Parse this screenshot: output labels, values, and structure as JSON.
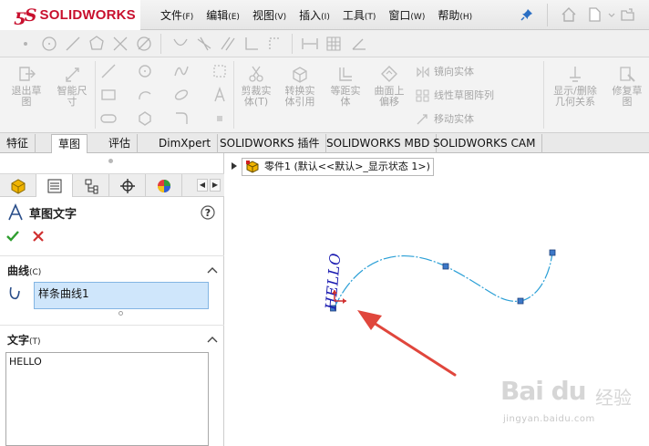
{
  "app": {
    "logo_mark": "ƽS",
    "logo_text": "SOLIDWORKS",
    "brand_color": "#c8102e"
  },
  "menu": [
    {
      "label": "文件",
      "acc": "(F)"
    },
    {
      "label": "编辑",
      "acc": "(E)"
    },
    {
      "label": "视图",
      "acc": "(V)"
    },
    {
      "label": "插入",
      "acc": "(I)"
    },
    {
      "label": "工具",
      "acc": "(T)"
    },
    {
      "label": "窗口",
      "acc": "(W)"
    },
    {
      "label": "帮助",
      "acc": "(H)"
    }
  ],
  "ribbon": {
    "exit_sketch": [
      "退出草",
      "图"
    ],
    "smart_dimension": [
      "智能尺",
      "寸"
    ],
    "trim": [
      "剪裁实",
      "体(T)"
    ],
    "convert": [
      "转换实",
      "体引用"
    ],
    "offset": [
      "等距实",
      "体"
    ],
    "surface_offset": [
      "曲面上",
      "偏移"
    ],
    "mirror": "镜向实体",
    "pattern": "线性草图阵列",
    "move": "移动实体",
    "display_delete": [
      "显示/删除",
      "几何关系"
    ],
    "repair": [
      "修复草",
      "图"
    ],
    "disabled_color": "#a7a7a7"
  },
  "cm_tabs": [
    {
      "label": "特征",
      "active": false
    },
    {
      "label": "草图",
      "active": true
    },
    {
      "label": "评估",
      "active": false
    },
    {
      "label": "DimXpert",
      "active": false
    },
    {
      "label": "SOLIDWORKS 插件",
      "active": false
    },
    {
      "label": "SOLIDWORKS MBD",
      "active": false
    },
    {
      "label": "SOLIDWORKS CAM",
      "active": false
    }
  ],
  "property_manager": {
    "title": "草图文字",
    "curves_section": {
      "title": "曲线",
      "acc": "(C)",
      "items": [
        "样条曲线1"
      ]
    },
    "text_section": {
      "title": "文字",
      "acc": "(T)",
      "value": "HELLO"
    }
  },
  "feature_tree": {
    "node_label": "零件1  (默认<<默认>_显示状态 1>)"
  },
  "sketch": {
    "text_on_curve": "HELLO",
    "curve_color": "#2a9fd6",
    "text_color": "#1a1ab0",
    "arrow_color": "#e0463c"
  },
  "watermark": {
    "brand": "Bai du",
    "cn": "经验",
    "url": "jingyan.baidu.com"
  }
}
